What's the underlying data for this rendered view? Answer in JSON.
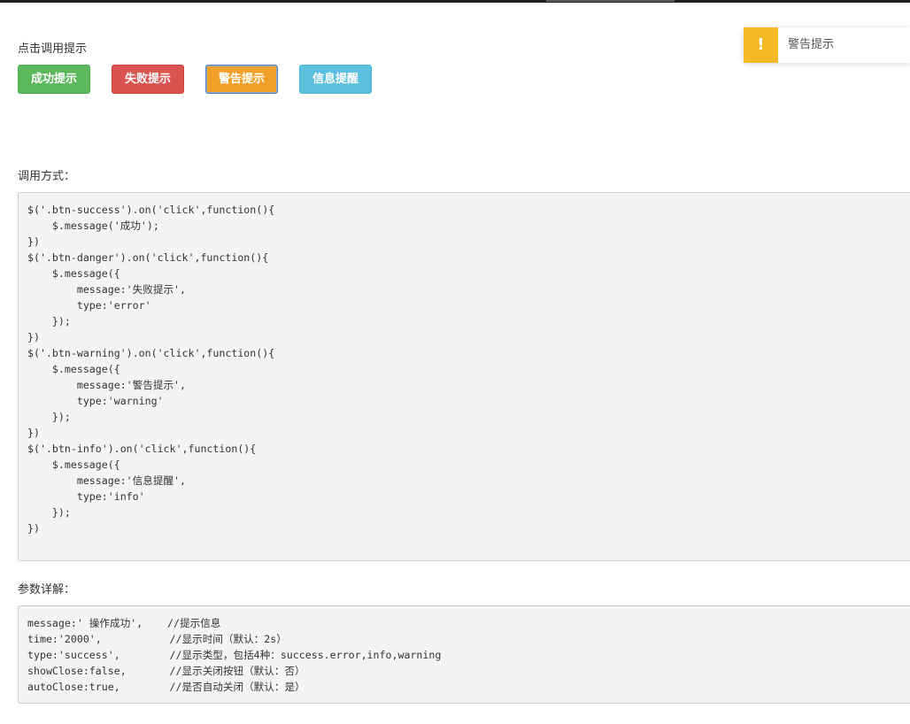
{
  "demo": {
    "label": "点击调用提示",
    "buttons": [
      {
        "label": "成功提示",
        "color": "#5cb85c"
      },
      {
        "label": "失败提示",
        "color": "#d9534f"
      },
      {
        "label": "警告提示",
        "color": "#f0a028"
      },
      {
        "label": "信息提醒",
        "color": "#5bc0de"
      }
    ]
  },
  "toast": {
    "icon": "exclamation-icon",
    "icon_glyph": "!",
    "message": "警告提示",
    "color": "#f6b926"
  },
  "usage": {
    "label": "调用方式：",
    "code_lines": [
      "$('.btn-success').on('click',function(){",
      "    $.message('成功');",
      "})",
      "$('.btn-danger').on('click',function(){",
      "    $.message({",
      "        message:'失败提示',",
      "        type:'error'",
      "    });",
      "})",
      "$('.btn-warning').on('click',function(){",
      "    $.message({",
      "        message:'警告提示',",
      "        type:'warning'",
      "    });",
      "})",
      "$('.btn-info').on('click',function(){",
      "    $.message({",
      "        message:'信息提醒',",
      "        type:'info'",
      "    });",
      "})"
    ]
  },
  "params": {
    "label": "参数详解：",
    "code_lines": [
      "message:' 操作成功',    //提示信息",
      "time:'2000',           //显示时间（默认：2s）",
      "type:'success',        //显示类型，包括4种：success.error,info,warning",
      "showClose:false,       //显示关闭按钮（默认：否）",
      "autoClose:true,        //是否自动关闭（默认：是）"
    ]
  }
}
